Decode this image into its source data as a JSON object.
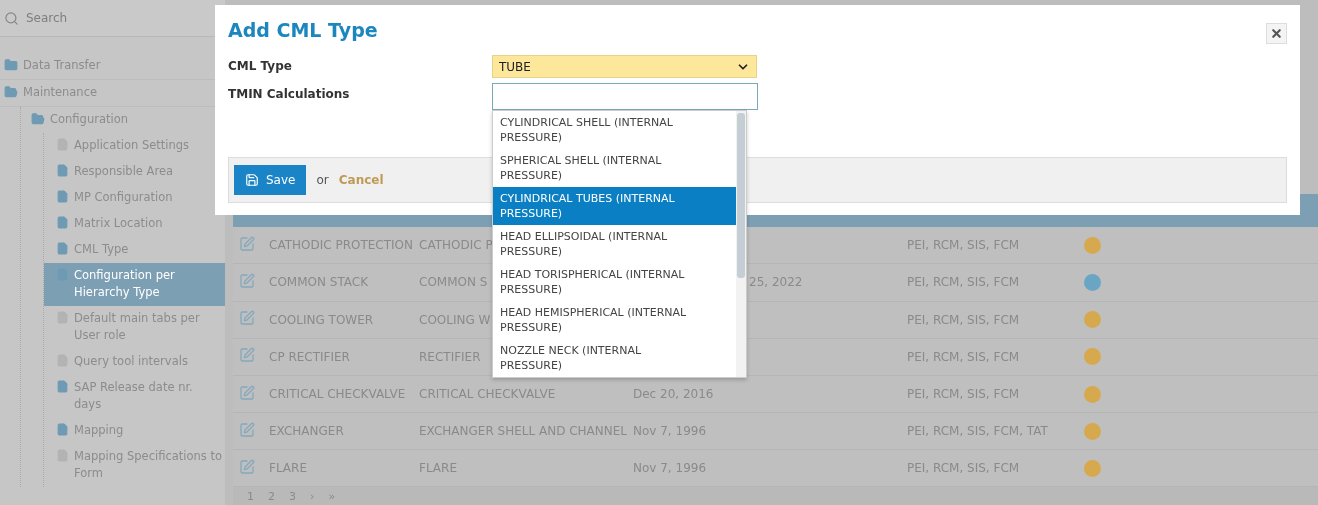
{
  "sidebar": {
    "search": {
      "placeholder": "Search"
    },
    "tree": [
      {
        "label": "Data Transfer",
        "expanded": false,
        "selected": false
      },
      {
        "label": "Maintenance",
        "expanded": true,
        "selected": false,
        "children": [
          {
            "label": "Configuration",
            "expanded": true,
            "selected": false,
            "children": [
              {
                "label": "Application Settings",
                "kind": "inactive",
                "selected": false
              },
              {
                "label": "Responsible Area",
                "kind": "page",
                "selected": false
              },
              {
                "label": "MP Configuration",
                "kind": "page",
                "selected": false
              },
              {
                "label": "Matrix Location",
                "kind": "page",
                "selected": false
              },
              {
                "label": "CML Type",
                "kind": "page",
                "selected": false
              },
              {
                "label": "Configuration per Hierarchy Type",
                "kind": "page",
                "selected": true
              },
              {
                "label": "Default main tabs per User role",
                "kind": "inactive",
                "selected": false
              },
              {
                "label": "Query tool intervals",
                "kind": "inactive",
                "selected": false
              },
              {
                "label": "SAP Release date nr. days",
                "kind": "page",
                "selected": false
              },
              {
                "label": "Mapping",
                "kind": "page",
                "selected": false
              },
              {
                "label": "Mapping Specifications to Form",
                "kind": "inactive",
                "selected": false
              }
            ]
          }
        ]
      }
    ]
  },
  "table": {
    "rows": [
      {
        "name": "CATHODIC PROTECTION",
        "description": "CATHODIC P",
        "modules": "PEI, RCM, SIS, FCM",
        "color": "#d6a94e"
      },
      {
        "name": "COMMON STACK",
        "description": "COMMON S",
        "date": "25, 2022",
        "date_clipped": true,
        "modules": "PEI, RCM, SIS, FCM",
        "color": "#6aa6c4"
      },
      {
        "name": "COOLING TOWER",
        "description": "COOLING W",
        "modules": "PEI, RCM, SIS, FCM",
        "color": "#d6a94e"
      },
      {
        "name": "CP RECTIFIER",
        "description": "RECTIFIER",
        "modules": "PEI, RCM, SIS, FCM",
        "color": "#d6a94e"
      },
      {
        "name": "CRITICAL CHECKVALVE",
        "description": "CRITICAL CHECKVALVE",
        "date": "Dec 20, 2016",
        "date_clipped": false,
        "modules": "PEI, RCM, SIS, FCM",
        "color": "#d6a94e"
      },
      {
        "name": "EXCHANGER",
        "description": "EXCHANGER SHELL AND CHANNEL",
        "date": "Nov 7, 1996",
        "date_clipped": false,
        "modules": "PEI, RCM, SIS, FCM, TAT",
        "color": "#d6a94e"
      },
      {
        "name": "FLARE",
        "description": "FLARE",
        "date": "Nov 7, 1996",
        "date_clipped": false,
        "modules": "PEI, RCM, SIS, FCM",
        "color": "#d6a94e"
      }
    ],
    "pagination": {
      "pages": [
        "1",
        "2",
        "3"
      ],
      "next": "›",
      "last": "»"
    }
  },
  "modal": {
    "title": "Add CML Type",
    "fields": [
      {
        "label": "CML Type",
        "kind": "select",
        "value": "TUBE"
      },
      {
        "label": "TMIN Calculations",
        "kind": "combo",
        "options": [
          {
            "label": "CYLINDRICAL SHELL (INTERNAL PRESSURE)",
            "selected": false
          },
          {
            "label": "SPHERICAL SHELL (INTERNAL PRESSURE)",
            "selected": false
          },
          {
            "label": "CYLINDRICAL TUBES (INTERNAL PRESSURE)",
            "selected": true
          },
          {
            "label": "HEAD ELLIPSOIDAL (INTERNAL PRESSURE)",
            "selected": false
          },
          {
            "label": "HEAD TORISPHERICAL (INTERNAL PRESSURE)",
            "selected": false
          },
          {
            "label": "HEAD HEMISPHERICAL (INTERNAL PRESSURE)",
            "selected": false
          },
          {
            "label": "NOZZLE NECK (INTERNAL PRESSURE)",
            "selected": false
          }
        ]
      }
    ],
    "footer": {
      "save": "Save",
      "or": "or",
      "cancel": "Cancel"
    }
  }
}
